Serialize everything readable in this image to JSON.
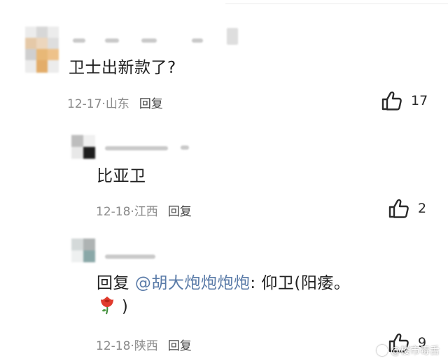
{
  "comments": [
    {
      "text": "卫士出新款了?",
      "date": "12-17",
      "separator": "·",
      "location": "山东",
      "reply_label": "回复",
      "likes": "17"
    },
    {
      "text": "比亚卫",
      "date": "12-18",
      "separator": "·",
      "location": "江西",
      "reply_label": "回复",
      "likes": "2"
    },
    {
      "reply_prefix": "回复",
      "mention": "@胡大炮炮炮炮",
      "body_after_mention": ": 仰卫(阳痿。",
      "line2_close": ")",
      "date": "12-18",
      "separator": "·",
      "location": "陕西",
      "reply_label": "回复",
      "likes": "9"
    }
  ],
  "watermark": {
    "text": "@楼市毒舌"
  },
  "icons": {
    "like": "thumbs-up-icon",
    "emoji": "rose-icon"
  },
  "colors": {
    "mention": "#5a7ba8",
    "meta": "#8a8a8a",
    "text": "#1f1f1f"
  }
}
